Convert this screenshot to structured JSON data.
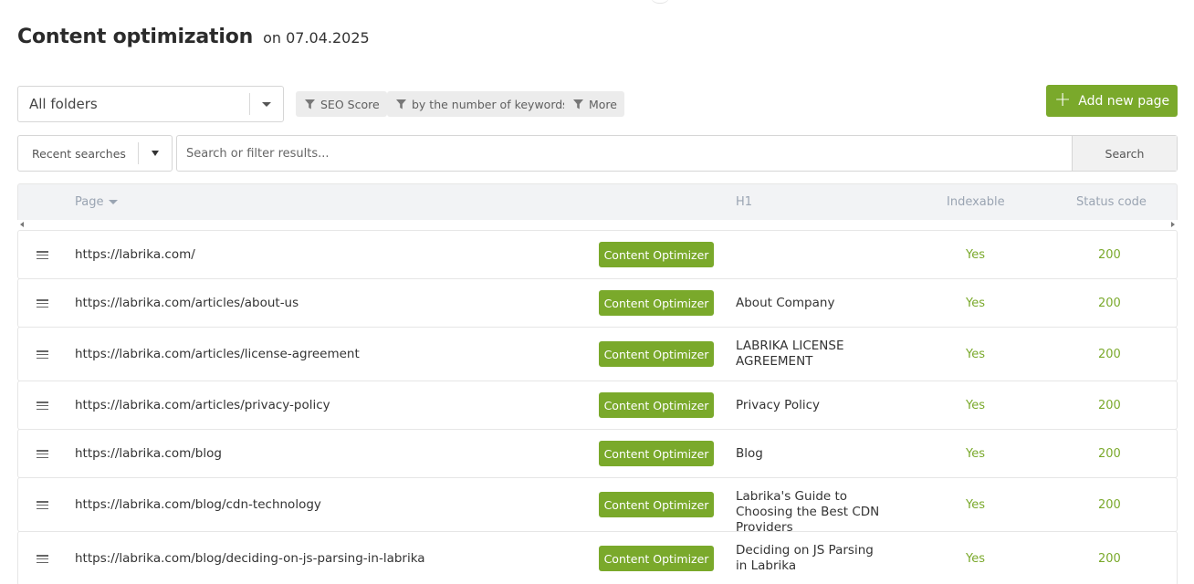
{
  "header": {
    "title": "Content optimization",
    "date": "on 07.04.2025"
  },
  "filters": {
    "folder_select": "All folders",
    "chips": [
      "SEO Score",
      "by the number of keywords",
      "More"
    ],
    "add_button": "Add new page",
    "recent_searches": "Recent searches",
    "search_placeholder": "Search or filter results...",
    "search_button": "Search"
  },
  "table": {
    "columns": {
      "page": "Page",
      "h1": "H1",
      "indexable": "Indexable",
      "status": "Status code"
    },
    "action_label": "Content Optimizer",
    "rows": [
      {
        "url": "https://labrika.com/",
        "h1": "",
        "indexable": "Yes",
        "status": "200"
      },
      {
        "url": "https://labrika.com/articles/about-us",
        "h1": "About Company",
        "indexable": "Yes",
        "status": "200"
      },
      {
        "url": "https://labrika.com/articles/license-agreement",
        "h1": "LABRIKA LICENSE AGREEMENT",
        "indexable": "Yes",
        "status": "200"
      },
      {
        "url": "https://labrika.com/articles/privacy-policy",
        "h1": "Privacy Policy",
        "indexable": "Yes",
        "status": "200"
      },
      {
        "url": "https://labrika.com/blog",
        "h1": "Blog",
        "indexable": "Yes",
        "status": "200"
      },
      {
        "url": "https://labrika.com/blog/cdn-technology",
        "h1": "Labrika's Guide to Choosing the Best CDN Providers",
        "indexable": "Yes",
        "status": "200"
      },
      {
        "url": "https://labrika.com/blog/deciding-on-js-parsing-in-labrika",
        "h1": "Deciding on JS Parsing in Labrika",
        "indexable": "Yes",
        "status": "200"
      }
    ]
  },
  "colors": {
    "accent": "#7aa92b",
    "header_bg": "#f2f3f5",
    "header_text": "#9aa4b2"
  },
  "icons": [
    "filter-icon",
    "plus-icon",
    "chevron-down-icon",
    "drag-handle-icon",
    "sort-arrow-icon"
  ]
}
